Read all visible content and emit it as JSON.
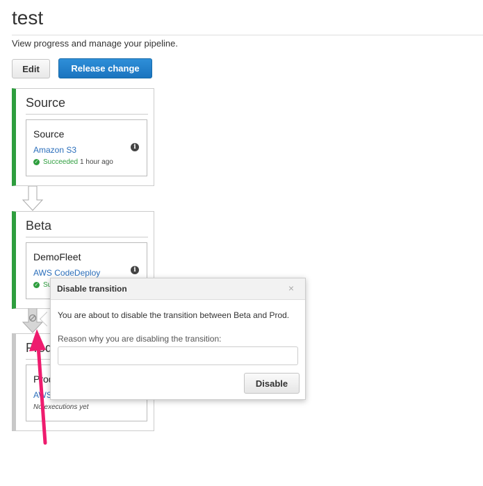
{
  "page": {
    "title": "test",
    "subtitle": "View progress and manage your pipeline."
  },
  "toolbar": {
    "edit_label": "Edit",
    "release_label": "Release change"
  },
  "stages": [
    {
      "name": "Source",
      "status_color": "#2e9e3e",
      "action": {
        "name": "Source",
        "provider": "Amazon S3",
        "status": "Succeeded",
        "time": "1 hour ago"
      }
    },
    {
      "name": "Beta",
      "status_color": "#2e9e3e",
      "action": {
        "name": "DemoFleet",
        "provider": "AWS CodeDeploy",
        "status": "Su"
      }
    },
    {
      "name": "Prod",
      "status_color": "#c8c8c8",
      "action": {
        "name": "Prod",
        "provider": "AWS",
        "status": "No executions yet"
      }
    }
  ],
  "dialog": {
    "title": "Disable transition",
    "close_symbol": "×",
    "message": "You are about to disable the transition between Beta and Prod.",
    "reason_label": "Reason why you are disabling the transition:",
    "reason_value": "",
    "disable_label": "Disable"
  },
  "icons": {
    "info": "info-icon",
    "succeeded": "check-circle-icon",
    "transition_disabled": "disabled-transition-icon"
  },
  "annotation": {
    "pointer_color": "#ee1c6e"
  }
}
